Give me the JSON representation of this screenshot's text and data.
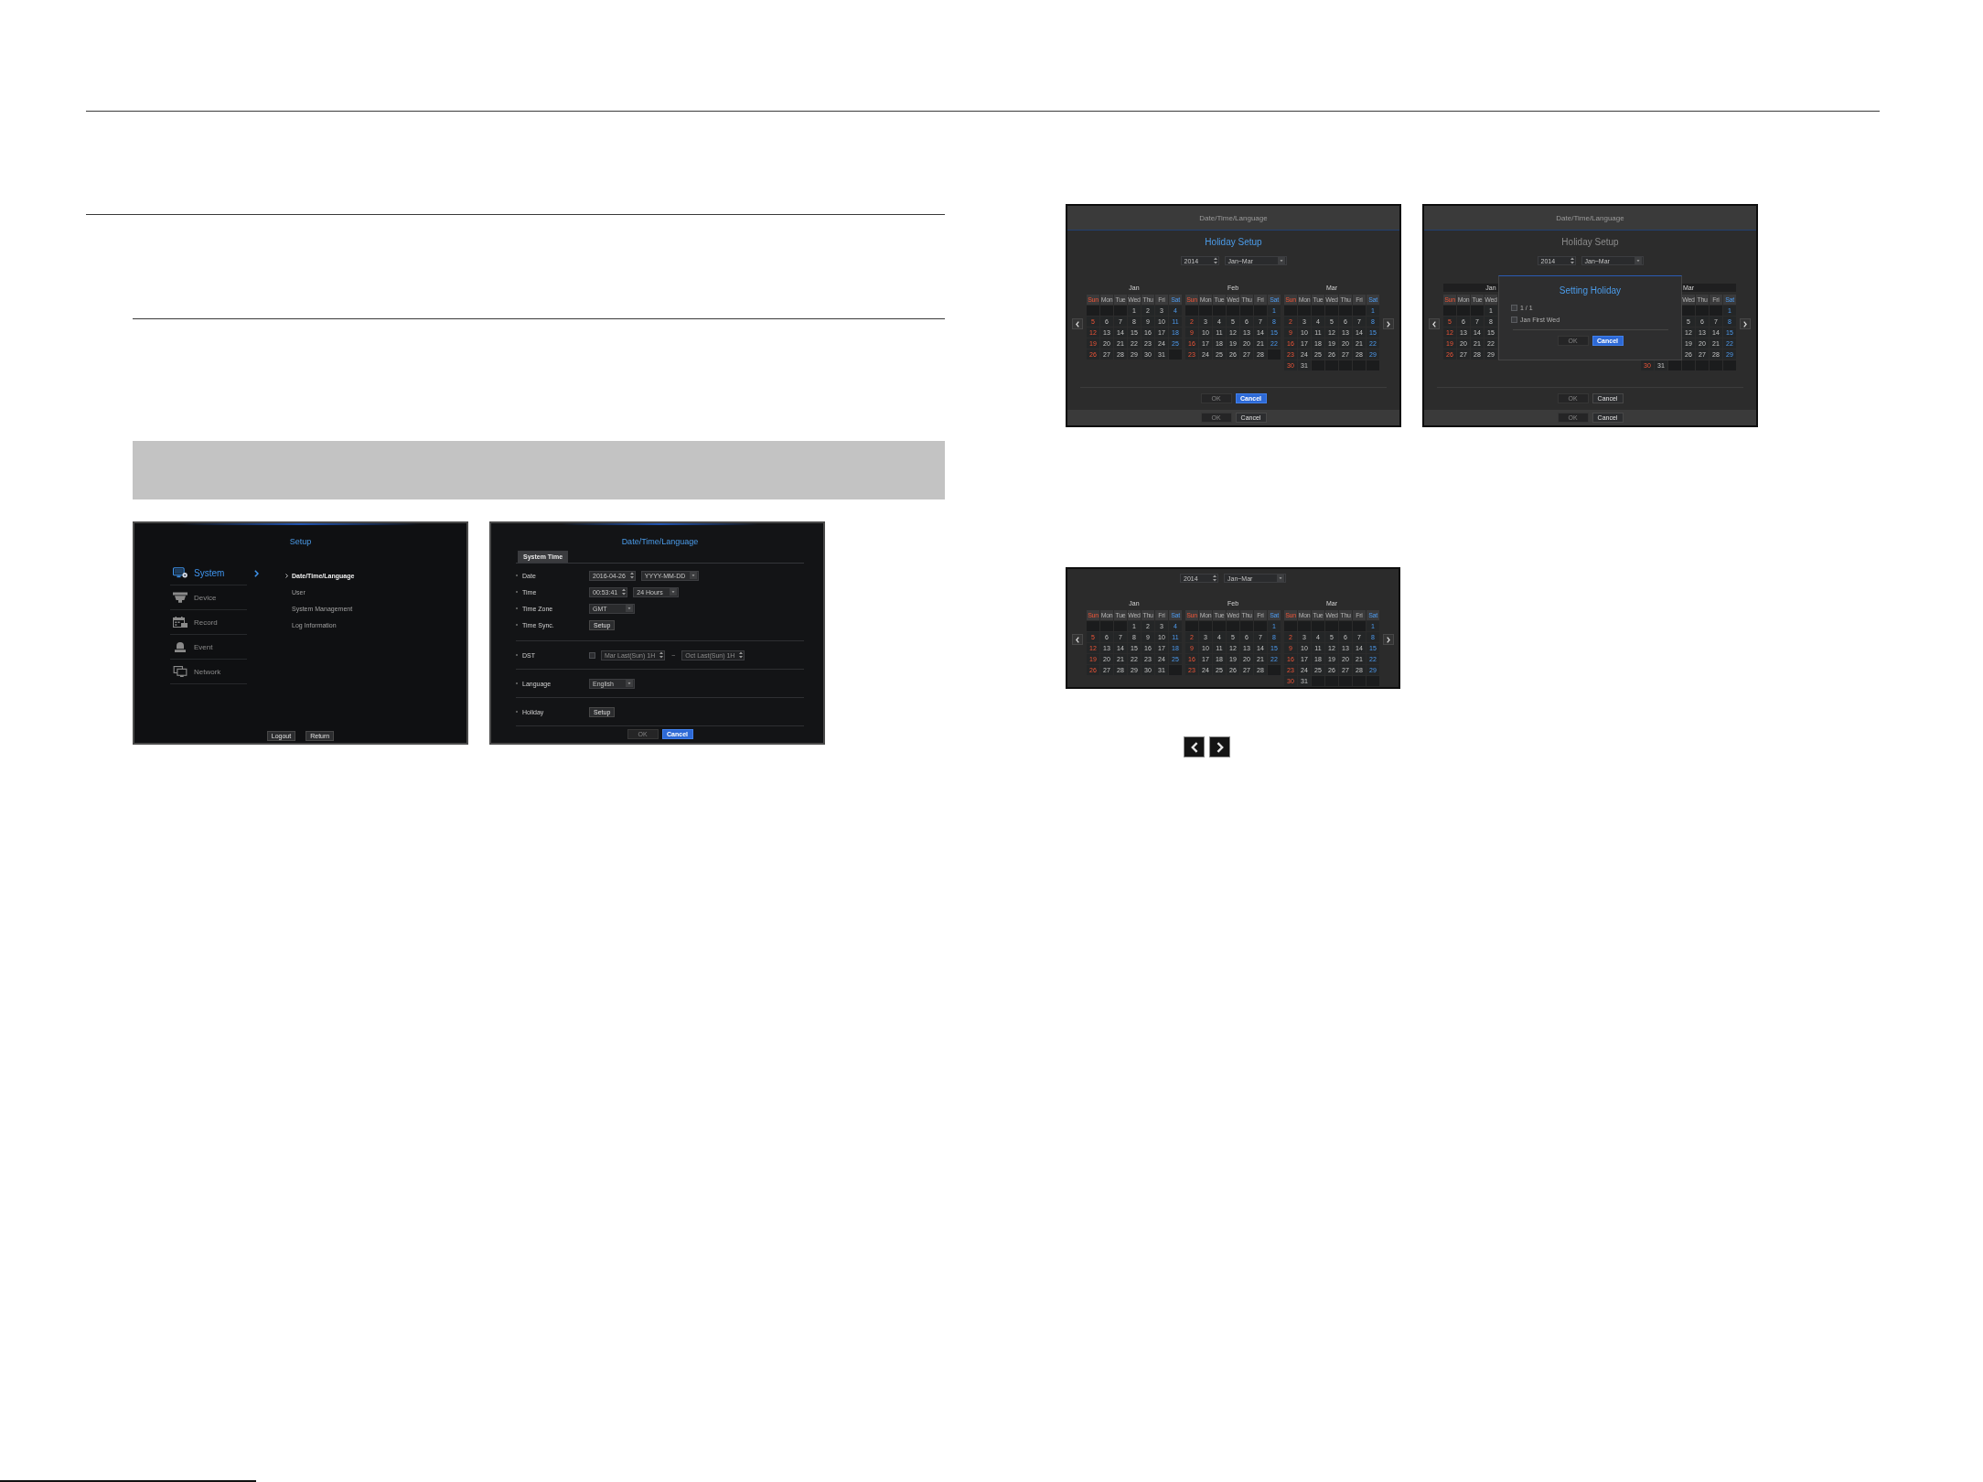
{
  "setup_screen": {
    "title": "Setup",
    "menu": [
      {
        "label": "System",
        "selected": true
      },
      {
        "label": "Device",
        "selected": false
      },
      {
        "label": "Record",
        "selected": false
      },
      {
        "label": "Event",
        "selected": false
      },
      {
        "label": "Network",
        "selected": false
      }
    ],
    "submenu": [
      {
        "label": "Date/Time/Language",
        "selected": true
      },
      {
        "label": "User",
        "selected": false
      },
      {
        "label": "System Management",
        "selected": false
      },
      {
        "label": "Log Information",
        "selected": false
      }
    ],
    "buttons": [
      "Logout",
      "Return"
    ]
  },
  "datetime_screen": {
    "title": "Date/Time/Language",
    "tabs": [
      {
        "label": "System Time",
        "selected": true
      }
    ],
    "sections": [
      {
        "rows": [
          {
            "label": "Date",
            "disabled": false,
            "controls": [
              {
                "kind": "spinner",
                "value": "2016-04-26"
              },
              {
                "kind": "dropdown",
                "value": "YYYY-MM-DD"
              }
            ]
          },
          {
            "label": "Time",
            "disabled": false,
            "controls": [
              {
                "kind": "spinner",
                "value": "00:53:41"
              },
              {
                "kind": "dropdown",
                "value": "24 Hours"
              }
            ]
          },
          {
            "label": "Time Zone",
            "disabled": false,
            "controls": [
              {
                "kind": "dropdown",
                "value": "GMT"
              }
            ]
          },
          {
            "label": "Time Sync.",
            "disabled": false,
            "controls": [
              {
                "kind": "button",
                "value": "Setup"
              }
            ]
          }
        ]
      },
      {
        "rows": [
          {
            "label": "DST",
            "disabled": true,
            "controls": [
              {
                "kind": "checkbox",
                "checked": false
              },
              {
                "kind": "spinner",
                "value": "Mar Last(Sun) 1H"
              },
              {
                "kind": "text",
                "value": "~"
              },
              {
                "kind": "spinner",
                "value": "Oct Last(Sun) 1H"
              }
            ]
          }
        ]
      },
      {
        "rows": [
          {
            "label": "Language",
            "disabled": false,
            "controls": [
              {
                "kind": "dropdown",
                "value": "English"
              }
            ]
          }
        ]
      },
      {
        "rows": [
          {
            "label": "Holiday",
            "disabled": false,
            "controls": [
              {
                "kind": "button",
                "value": "Setup"
              }
            ]
          }
        ]
      }
    ],
    "buttons": [
      {
        "label": "OK",
        "disabled": true,
        "selected": false
      },
      {
        "label": "Cancel",
        "disabled": false,
        "selected": true
      }
    ]
  },
  "holiday_setup_screen": {
    "parent_title": "Date/Time/Language",
    "title": "Holiday Setup",
    "dimmed": false,
    "year": "2014",
    "range": "Jan~Mar",
    "months": [
      {
        "name": "Jan",
        "weekdays": {
          "sun": "Sun",
          "mon": "Mon",
          "tue": "Tue",
          "wed": "Wed",
          "thu": "Thu",
          "fri": "Fri",
          "sat": "Sat"
        },
        "weeks": [
          {
            "wed": "1",
            "thu": "2",
            "fri": "3",
            "sat": "4"
          },
          {
            "sun": "5",
            "mon": "6",
            "tue": "7",
            "wed": "8",
            "thu": "9",
            "fri": "10",
            "sat": "11"
          },
          {
            "sun": "12",
            "mon": "13",
            "tue": "14",
            "wed": "15",
            "thu": "16",
            "fri": "17",
            "sat": "18"
          },
          {
            "sun": "19",
            "mon": "20",
            "tue": "21",
            "wed": "22",
            "thu": "23",
            "fri": "24",
            "sat": "25"
          },
          {
            "sun": "26",
            "mon": "27",
            "tue": "28",
            "wed": "29",
            "thu": "30",
            "fri": "31"
          }
        ]
      },
      {
        "name": "Feb",
        "weekdays": {
          "sun": "Sun",
          "mon": "Mon",
          "tue": "Tue",
          "wed": "Wed",
          "thu": "Thu",
          "fri": "Fri",
          "sat": "Sat"
        },
        "weeks": [
          {
            "sat": "1"
          },
          {
            "sun": "2",
            "mon": "3",
            "tue": "4",
            "wed": "5",
            "thu": "6",
            "fri": "7",
            "sat": "8"
          },
          {
            "sun": "9",
            "mon": "10",
            "tue": "11",
            "wed": "12",
            "thu": "13",
            "fri": "14",
            "sat": "15"
          },
          {
            "sun": "16",
            "mon": "17",
            "tue": "18",
            "wed": "19",
            "thu": "20",
            "fri": "21",
            "sat": "22"
          },
          {
            "sun": "23",
            "mon": "24",
            "tue": "25",
            "wed": "26",
            "thu": "27",
            "fri": "28"
          }
        ]
      },
      {
        "name": "Mar",
        "weekdays": {
          "sun": "Sun",
          "mon": "Mon",
          "tue": "Tue",
          "wed": "Wed",
          "thu": "Thu",
          "fri": "Fri",
          "sat": "Sat"
        },
        "weeks": [
          {
            "sat": "1"
          },
          {
            "sun": "2",
            "mon": "3",
            "tue": "4",
            "wed": "5",
            "thu": "6",
            "fri": "7",
            "sat": "8"
          },
          {
            "sun": "9",
            "mon": "10",
            "tue": "11",
            "wed": "12",
            "thu": "13",
            "fri": "14",
            "sat": "15"
          },
          {
            "sun": "16",
            "mon": "17",
            "tue": "18",
            "wed": "19",
            "thu": "20",
            "fri": "21",
            "sat": "22"
          },
          {
            "sun": "23",
            "mon": "24",
            "tue": "25",
            "wed": "26",
            "thu": "27",
            "fri": "28",
            "sat": "29"
          },
          {
            "sun": "30",
            "mon": "31"
          }
        ]
      }
    ],
    "buttons": [
      {
        "label": "OK",
        "disabled": true,
        "selected": false
      },
      {
        "label": "Cancel",
        "disabled": false,
        "selected": true
      }
    ],
    "parent_buttons": [
      {
        "label": "OK",
        "disabled": true,
        "selected": false
      },
      {
        "label": "Cancel",
        "disabled": false,
        "selected": false
      }
    ]
  },
  "setting_holiday_screen": {
    "parent_title": "Date/Time/Language",
    "title": "Holiday Setup",
    "dimmed": true,
    "year": "2014",
    "range": "Jan~Mar",
    "months": [
      {
        "name": "Jan",
        "weekdays": {
          "sun": "Sun",
          "mon": "Mon",
          "tue": "Tue",
          "wed": "Wed"
        },
        "weeks": [
          {
            "wed": "1"
          },
          {
            "sun": "5",
            "mon": "6",
            "tue": "7",
            "wed": "8"
          },
          {
            "sun": "12",
            "mon": "13",
            "tue": "14",
            "wed": "15"
          },
          {
            "sun": "19",
            "mon": "20",
            "tue": "21",
            "wed": "22"
          },
          {
            "sun": "26",
            "mon": "27",
            "tue": "28",
            "wed": "29"
          }
        ]
      },
      {
        "name": "Mar",
        "weekdays": {
          "wed": "Wed",
          "thu": "Thu",
          "fri": "Fri",
          "sat": "Sat"
        },
        "weeks": [
          {
            "sat": "1"
          },
          {
            "wed": "5",
            "thu": "6",
            "fri": "7",
            "sat": "8"
          },
          {
            "wed": "12",
            "thu": "13",
            "fri": "14",
            "sat": "15"
          },
          {
            "wed": "19",
            "thu": "20",
            "fri": "21",
            "sat": "22"
          },
          {
            "wed": "26",
            "thu": "27",
            "fri": "28",
            "sat": "29"
          },
          {
            "sun": "30",
            "mon": "31"
          }
        ]
      }
    ],
    "buttons": [
      {
        "label": "OK",
        "disabled": true,
        "selected": false
      },
      {
        "label": "Cancel",
        "disabled": false,
        "selected": false
      }
    ],
    "parent_buttons": [
      {
        "label": "OK",
        "disabled": true,
        "selected": false
      },
      {
        "label": "Cancel",
        "disabled": false,
        "selected": false
      }
    ],
    "dialog": {
      "title": "Setting Holiday",
      "options": [
        {
          "label": "1 / 1",
          "checked": false
        },
        {
          "label": "Jan First Wed",
          "checked": false
        }
      ],
      "buttons": [
        {
          "label": "OK",
          "disabled": true,
          "selected": false
        },
        {
          "label": "Cancel",
          "disabled": false,
          "selected": true
        }
      ]
    }
  },
  "calendar_view": {
    "year": "2014",
    "range": "Jan~Mar",
    "months": [
      {
        "name": "Jan",
        "weekdays": {
          "sun": "Sun",
          "mon": "Mon",
          "tue": "Tue",
          "wed": "Wed",
          "thu": "Thu",
          "fri": "Fri",
          "sat": "Sat"
        },
        "weeks": [
          {
            "wed": "1",
            "thu": "2",
            "fri": "3",
            "sat": "4"
          },
          {
            "sun": "5",
            "mon": "6",
            "tue": "7",
            "wed": "8",
            "thu": "9",
            "fri": "10",
            "sat": "11"
          },
          {
            "sun": "12",
            "mon": "13",
            "tue": "14",
            "wed": "15",
            "thu": "16",
            "fri": "17",
            "sat": "18"
          },
          {
            "sun": "19",
            "mon": "20",
            "tue": "21",
            "wed": "22",
            "thu": "23",
            "fri": "24",
            "sat": "25"
          },
          {
            "sun": "26",
            "mon": "27",
            "tue": "28",
            "wed": "29",
            "thu": "30",
            "fri": "31"
          }
        ]
      },
      {
        "name": "Feb",
        "weekdays": {
          "sun": "Sun",
          "mon": "Mon",
          "tue": "Tue",
          "wed": "Wed",
          "thu": "Thu",
          "fri": "Fri",
          "sat": "Sat"
        },
        "weeks": [
          {
            "sat": "1"
          },
          {
            "sun": "2",
            "mon": "3",
            "tue": "4",
            "wed": "5",
            "thu": "6",
            "fri": "7",
            "sat": "8"
          },
          {
            "sun": "9",
            "mon": "10",
            "tue": "11",
            "wed": "12",
            "thu": "13",
            "fri": "14",
            "sat": "15"
          },
          {
            "sun": "16",
            "mon": "17",
            "tue": "18",
            "wed": "19",
            "thu": "20",
            "fri": "21",
            "sat": "22"
          },
          {
            "sun": "23",
            "mon": "24",
            "tue": "25",
            "wed": "26",
            "thu": "27",
            "fri": "28"
          }
        ]
      },
      {
        "name": "Mar",
        "weekdays": {
          "sun": "Sun",
          "mon": "Mon",
          "tue": "Tue",
          "wed": "Wed",
          "thu": "Thu",
          "fri": "Fri",
          "sat": "Sat"
        },
        "weeks": [
          {
            "sat": "1"
          },
          {
            "sun": "2",
            "mon": "3",
            "tue": "4",
            "wed": "5",
            "thu": "6",
            "fri": "7",
            "sat": "8"
          },
          {
            "sun": "9",
            "mon": "10",
            "tue": "11",
            "wed": "12",
            "thu": "13",
            "fri": "14",
            "sat": "15"
          },
          {
            "sun": "16",
            "mon": "17",
            "tue": "18",
            "wed": "19",
            "thu": "20",
            "fri": "21",
            "sat": "22"
          },
          {
            "sun": "23",
            "mon": "24",
            "tue": "25",
            "wed": "26",
            "thu": "27",
            "fri": "28",
            "sat": "29"
          },
          {
            "sun": "30",
            "mon": "31"
          }
        ]
      }
    ]
  }
}
